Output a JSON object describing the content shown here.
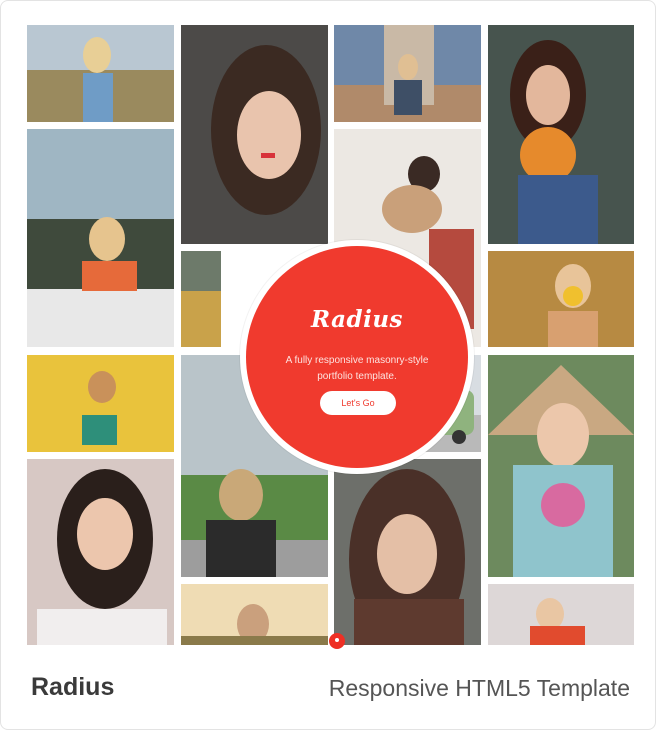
{
  "card": {
    "template_name": "Radius",
    "template_subtitle": "Responsive HTML5 Template"
  },
  "hero": {
    "title": "Radius",
    "tagline": "A fully responsive masonry-style portfolio template.",
    "button_label": "Let's Go",
    "accent_color": "#f03a2e"
  },
  "gallery": {
    "photo_count": 20,
    "icon": "photo-thumbnail"
  }
}
